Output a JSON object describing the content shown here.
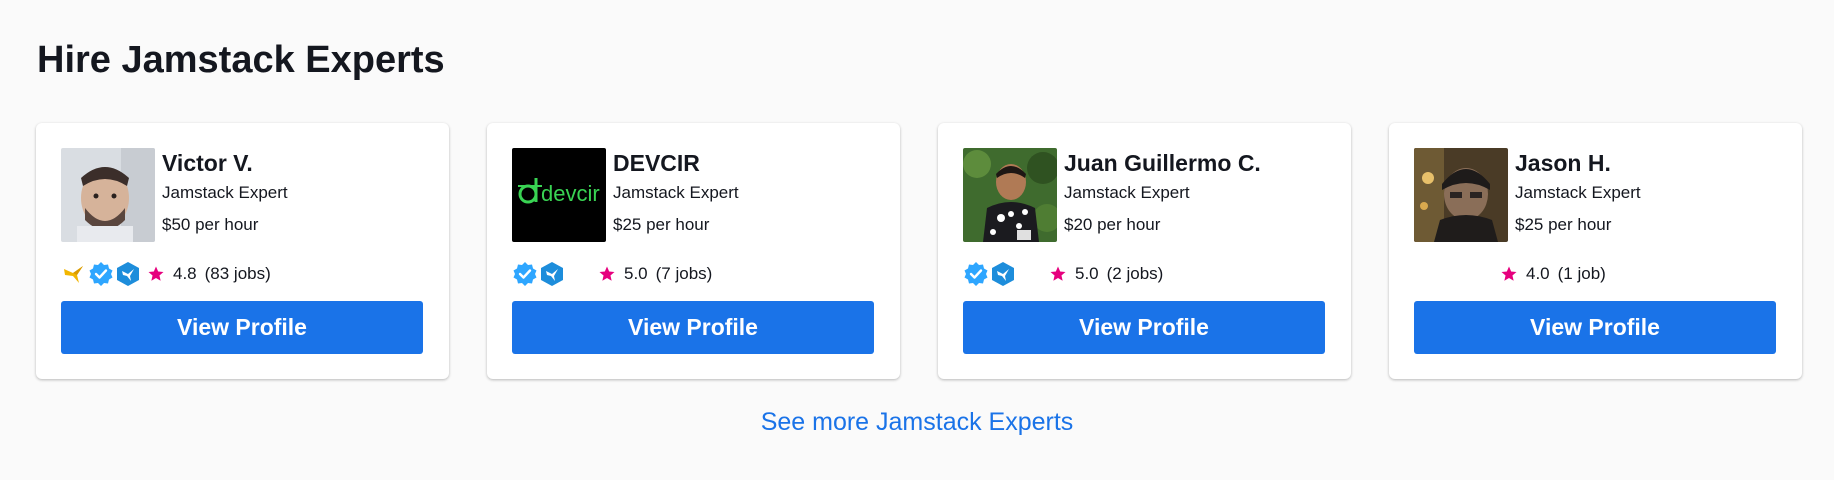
{
  "section": {
    "title": "Hire Jamstack Experts",
    "see_more": "See more Jamstack Experts"
  },
  "colors": {
    "accent": "#1a73e8",
    "star": "#e6007e",
    "verified": "#2ea6ff",
    "hex_badge": "#1d8ddb",
    "gold_badge": "#f2b600",
    "card_bg": "#ffffff",
    "page_bg": "#fafafa"
  },
  "experts": [
    {
      "name": "Victor V.",
      "role": "Jamstack Expert",
      "rate": "$50 per hour",
      "rating": "4.8",
      "jobs": "(83 jobs)",
      "button_label": "View Profile",
      "badges": [
        "gold-hummingbird-icon",
        "verified-icon",
        "hex-hummingbird-icon"
      ],
      "avatar": "profile-photo-icon"
    },
    {
      "name": "DEVCIR",
      "role": "Jamstack Expert",
      "rate": "$25 per hour",
      "rating": "5.0",
      "jobs": "(7 jobs)",
      "button_label": "View Profile",
      "badges": [
        "verified-icon",
        "hex-hummingbird-icon"
      ],
      "avatar": "devcir-logo",
      "logo_text": "devcir"
    },
    {
      "name": "Juan Guillermo C.",
      "role": "Jamstack Expert",
      "rate": "$20 per hour",
      "rating": "5.0",
      "jobs": "(2 jobs)",
      "button_label": "View Profile",
      "badges": [
        "verified-icon",
        "hex-hummingbird-icon"
      ],
      "avatar": "profile-photo-icon"
    },
    {
      "name": "Jason H.",
      "role": "Jamstack Expert",
      "rate": "$25 per hour",
      "rating": "4.0",
      "jobs": "(1 job)",
      "button_label": "View Profile",
      "badges": [],
      "avatar": "profile-photo-icon"
    }
  ]
}
